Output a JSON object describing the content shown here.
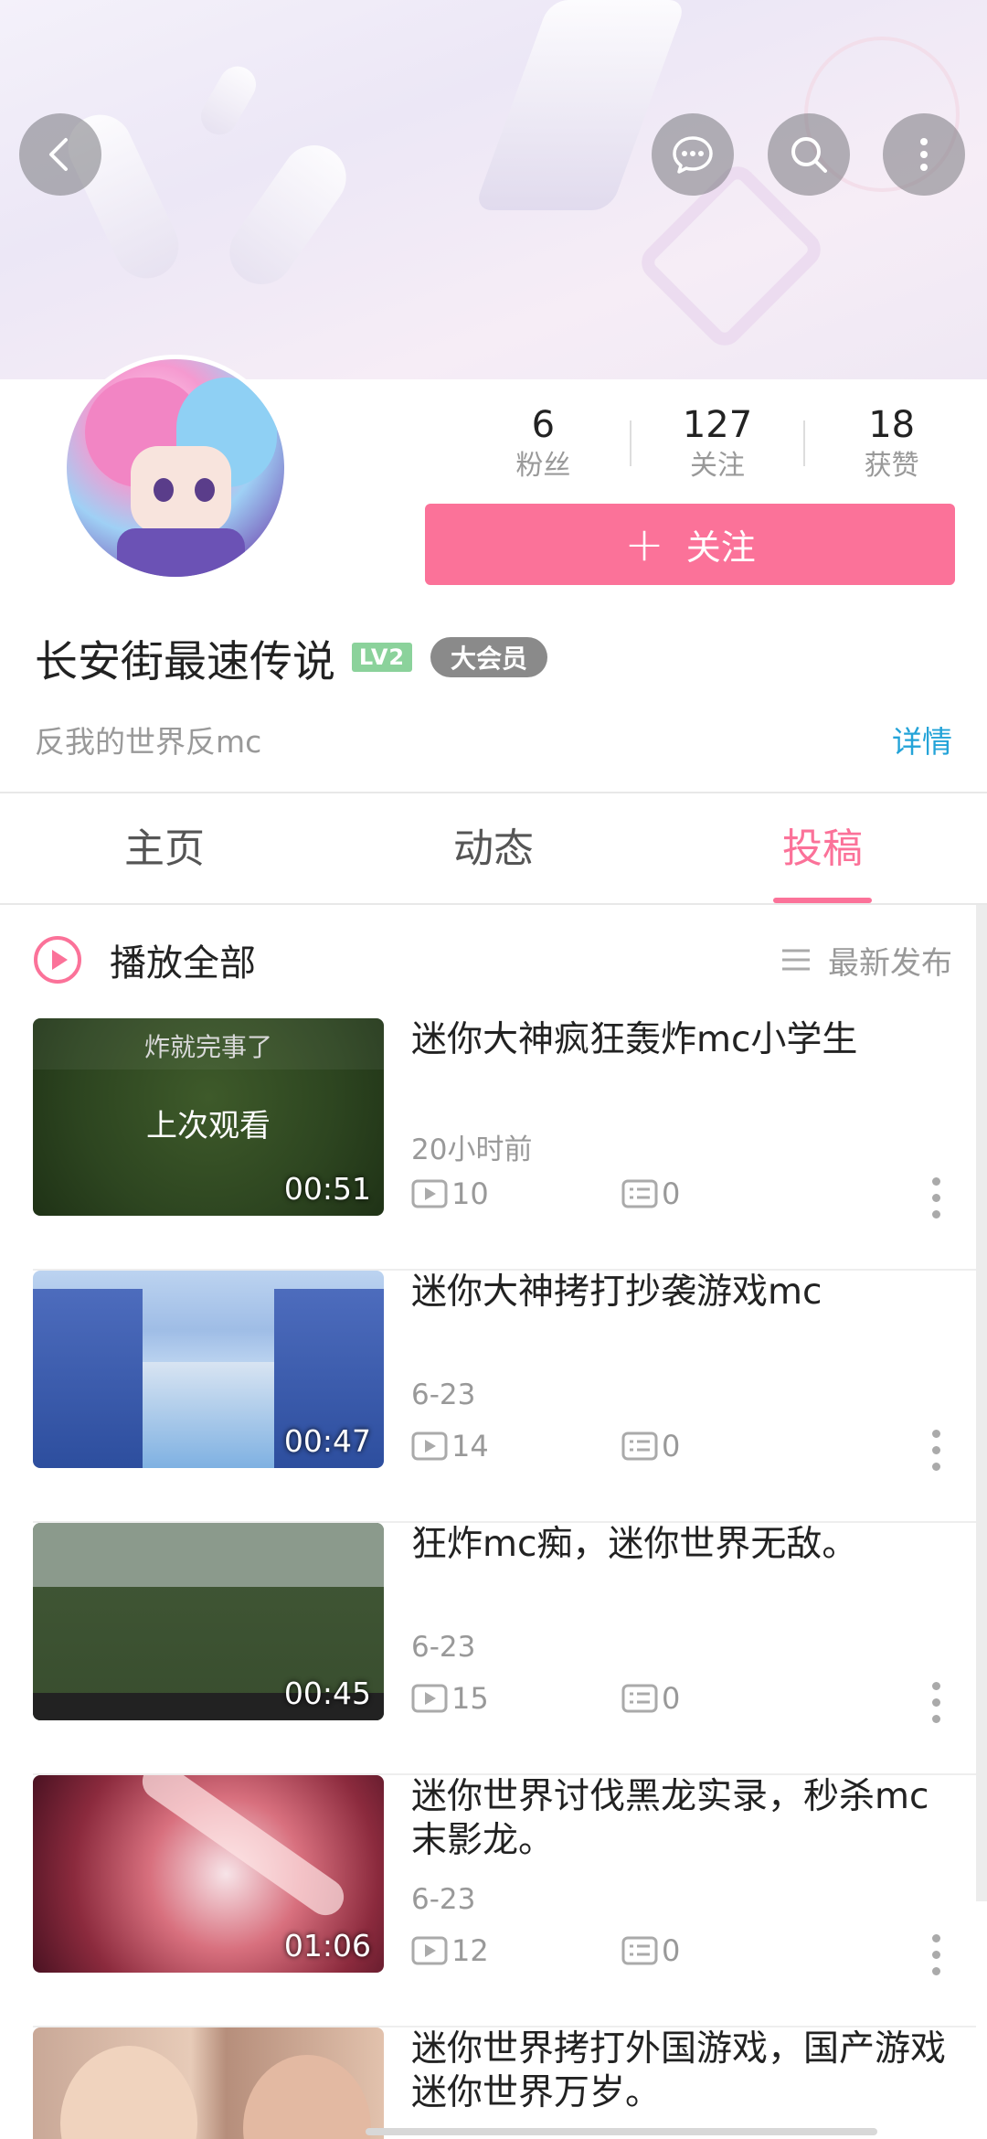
{
  "header": {
    "back_icon": "back-arrow-icon",
    "actions": [
      "message-icon",
      "search-icon",
      "more-vertical-icon"
    ]
  },
  "profile": {
    "stats": [
      {
        "value": "6",
        "label": "粉丝"
      },
      {
        "value": "127",
        "label": "关注"
      },
      {
        "value": "18",
        "label": "获赞"
      }
    ],
    "follow_label": "关注",
    "username": "长安街最速传说",
    "level_badge": "LV2",
    "vip_badge": "大会员",
    "signature": "反我的世界反mc",
    "details_link": "详情"
  },
  "tabs": [
    {
      "label": "主页",
      "active": false
    },
    {
      "label": "动态",
      "active": false
    },
    {
      "label": "投稿",
      "active": true
    }
  ],
  "list_header": {
    "play_all_label": "播放全部",
    "sort_label": "最新发布"
  },
  "videos": [
    {
      "title": "迷你大神疯狂轰炸mc小学生",
      "date": "20小时前",
      "plays": "10",
      "danmaku": "0",
      "duration": "00:51",
      "overlay_top": "炸就完事了",
      "overlay_mid": "上次观看"
    },
    {
      "title": "迷你大神拷打抄袭游戏mc",
      "date": "6-23",
      "plays": "14",
      "danmaku": "0",
      "duration": "00:47"
    },
    {
      "title": "狂炸mc痴，迷你世界无敌。",
      "date": "6-23",
      "plays": "15",
      "danmaku": "0",
      "duration": "00:45"
    },
    {
      "title": "迷你世界讨伐黑龙实录，秒杀mc末影龙。",
      "date": "6-23",
      "plays": "12",
      "danmaku": "0",
      "duration": "01:06"
    },
    {
      "title": "迷你世界拷打外国游戏，国产游戏迷你世界万岁。"
    }
  ],
  "colors": {
    "accent": "#fb7299",
    "link": "#23a3d8",
    "level_green": "#8bd29b",
    "vip_gray": "#8a8a8a"
  }
}
